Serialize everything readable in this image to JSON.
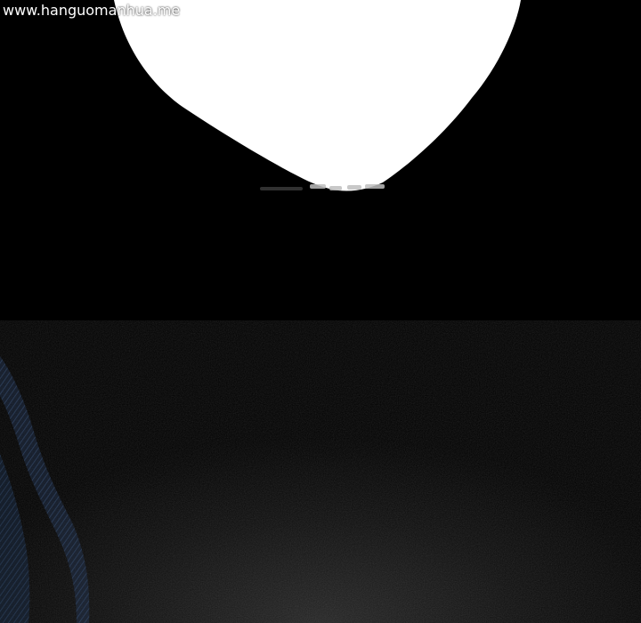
{
  "watermark": {
    "text": "www.hanguomanhua.me"
  },
  "scene": {
    "background_color": "#000000",
    "bubble_color": "#ffffff",
    "figure_color": "#2a3b55",
    "description_icons": [
      "speech-bubble",
      "dark-figure-silhouette"
    ]
  }
}
